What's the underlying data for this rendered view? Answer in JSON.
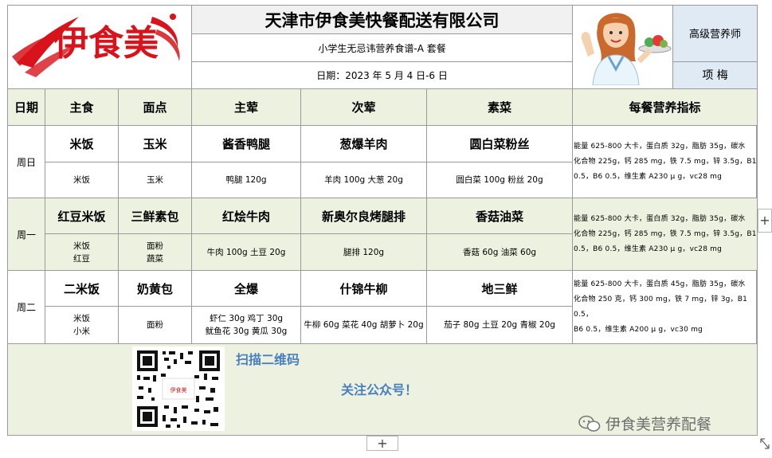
{
  "company": "天津市伊食美快餐配送有限公司",
  "logo_text": "伊食美",
  "menu_name": "小学生无忌讳营养食谱-A 套餐",
  "date_range": "日期：2023 年 5 月 4 日-6 日",
  "nutritionist": {
    "title": "高级营养师",
    "name": "项 梅"
  },
  "headers": {
    "day": "日期",
    "staple": "主食",
    "pastry": "面点",
    "main": "主荤",
    "second": "次荤",
    "veg": "素菜",
    "nutrition": "每餐营养指标"
  },
  "days": [
    {
      "day": "周日",
      "staple": "米饭",
      "pastry": "玉米",
      "main": "酱香鸭腿",
      "second": "葱爆羊肉",
      "veg": "圆白菜粉丝",
      "staple_ing": [
        "米饭"
      ],
      "pastry_ing": [
        "玉米"
      ],
      "main_ing": [
        "鸭腿 120g"
      ],
      "second_ing": [
        "羊肉 100g 大葱 20g"
      ],
      "veg_ing": [
        "圆白菜 100g 粉丝 20g"
      ],
      "nutrition": [
        "能量 625-800 大卡，蛋白质 32g，脂肪 35g，碳水",
        "化合物 225g，钙 285 mg，铁 7.5 mg，锌 3.5g，B1",
        "0.5，B6 0.5，维生素 A230 μ g，vc28 mg"
      ]
    },
    {
      "day": "周一",
      "staple": "红豆米饭",
      "pastry": "三鲜素包",
      "main": "红烩牛肉",
      "second": "新奥尔良烤腿排",
      "veg": "香菇油菜",
      "staple_ing": [
        "米饭",
        "红豆"
      ],
      "pastry_ing": [
        "面粉",
        "蔬菜"
      ],
      "main_ing": [
        "牛肉 100g 土豆 20g"
      ],
      "second_ing": [
        "腿排 120g"
      ],
      "veg_ing": [
        "香菇 60g 油菜 60g"
      ],
      "nutrition": [
        "能量 625-800 大卡，蛋白质 32g，脂肪 35g，碳水",
        "化合物 225g，钙 285 mg，铁 7.5 mg，锌 3.5g，B1",
        "0.5，B6 0.5，维生素 A230 μ g，vc28 mg"
      ]
    },
    {
      "day": "周二",
      "staple": "二米饭",
      "pastry": "奶黄包",
      "main": "全爆",
      "second": "什锦牛柳",
      "veg": "地三鲜",
      "staple_ing": [
        "米饭",
        "小米"
      ],
      "pastry_ing": [
        "面粉"
      ],
      "main_ing": [
        "虾仁 30g 鸡丁 30g",
        "鱿鱼花 30g 黄瓜 30g"
      ],
      "second_ing": [
        "牛柳 60g 菜花 40g 胡萝卜 20g"
      ],
      "veg_ing": [
        "茄子 80g 土豆 20g 青椒 20g"
      ],
      "nutrition": [
        "能量 625-800 大卡，蛋白质 45g，脂肪 35g，碳水",
        "化合物 250 克，钙 300 mg，铁 7 mg，锌 3g，B1 0.5，",
        "B6 0.5，维生素 A200 μ g，vc30 mg"
      ]
    }
  ],
  "footer": {
    "scan": "扫描二维码",
    "follow": "关注公众号！",
    "qr_center": "伊食美",
    "watermark": "伊食美营养配餐"
  },
  "colors": {
    "green": "#ecf2df",
    "blue": "#dfeaf5",
    "accent_blue": "#4a7ebf",
    "logo_red": "#d8131b"
  },
  "ui": {
    "add_label": "+"
  }
}
